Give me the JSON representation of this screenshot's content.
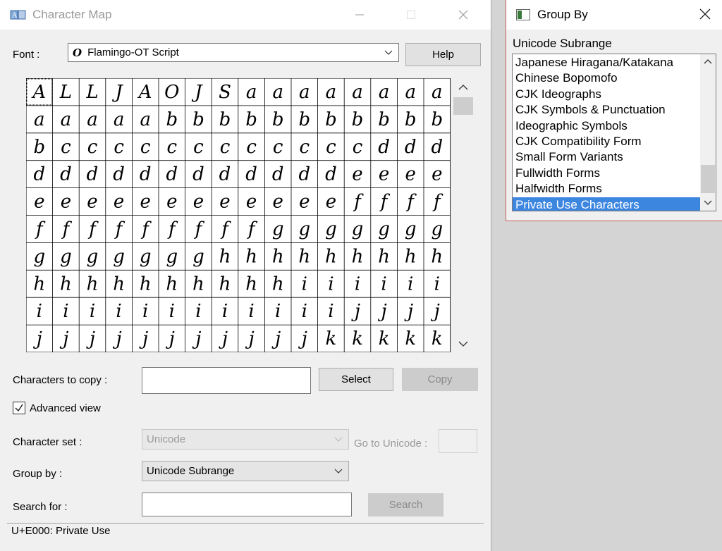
{
  "charmap": {
    "title": "Character Map",
    "font_label": "Font :",
    "font_value": "Flamingo-OT Script",
    "help_label": "Help",
    "chars_to_copy_label": "Characters to copy :",
    "chars_to_copy_value": "",
    "select_label": "Select",
    "copy_label": "Copy",
    "advanced_view_label": "Advanced view",
    "advanced_view_checked": true,
    "charset_label": "Character set :",
    "charset_value": "Unicode",
    "goto_unicode_label": "Go to Unicode :",
    "groupby_label": "Group by :",
    "groupby_value": "Unicode Subrange",
    "search_label": "Search for :",
    "search_value": "",
    "search_button_label": "Search",
    "status_text": "U+E000: Private Use",
    "grid": {
      "columns": 16,
      "rows": 10,
      "glyph_rows": [
        [
          "A",
          "L",
          "L",
          "J",
          "A",
          "O",
          "J",
          "S",
          "a",
          "a",
          "a",
          "a",
          "a",
          "a",
          "a",
          "a"
        ],
        [
          "a",
          "a",
          "a",
          "a",
          "a",
          "b",
          "b",
          "b",
          "b",
          "b",
          "b",
          "b",
          "b",
          "b",
          "b",
          "b"
        ],
        [
          "b",
          "c",
          "c",
          "c",
          "c",
          "c",
          "c",
          "c",
          "c",
          "c",
          "c",
          "c",
          "c",
          "d",
          "d",
          "d"
        ],
        [
          "d",
          "d",
          "d",
          "d",
          "d",
          "d",
          "d",
          "d",
          "d",
          "d",
          "d",
          "d",
          "e",
          "e",
          "e",
          "e"
        ],
        [
          "e",
          "e",
          "e",
          "e",
          "e",
          "e",
          "e",
          "e",
          "e",
          "e",
          "e",
          "e",
          "f",
          "f",
          "f",
          "f"
        ],
        [
          "f",
          "f",
          "f",
          "f",
          "f",
          "f",
          "f",
          "f",
          "f",
          "g",
          "g",
          "g",
          "g",
          "g",
          "g",
          "g"
        ],
        [
          "g",
          "g",
          "g",
          "g",
          "g",
          "g",
          "g",
          "h",
          "h",
          "h",
          "h",
          "h",
          "h",
          "h",
          "h",
          "h"
        ],
        [
          "h",
          "h",
          "h",
          "h",
          "h",
          "h",
          "h",
          "h",
          "h",
          "h",
          "i",
          "i",
          "i",
          "i",
          "i",
          "i"
        ],
        [
          "i",
          "i",
          "i",
          "i",
          "i",
          "i",
          "i",
          "i",
          "i",
          "i",
          "i",
          "i",
          "j",
          "j",
          "j",
          "j"
        ],
        [
          "j",
          "j",
          "j",
          "j",
          "j",
          "j",
          "j",
          "j",
          "j",
          "j",
          "j",
          "k",
          "k",
          "k",
          "k",
          "k"
        ]
      ]
    }
  },
  "groupby": {
    "title": "Group By",
    "header": "Unicode Subrange",
    "items": [
      "Japanese Hiragana/Katakana",
      "Chinese Bopomofo",
      "CJK Ideographs",
      "CJK Symbols & Punctuation",
      "Ideographic Symbols",
      "CJK Compatibility Form",
      "Small Form Variants",
      "Fullwidth Forms",
      "Halfwidth Forms",
      "Private Use Characters"
    ],
    "selected": "Private Use Characters"
  },
  "icons": [
    "charmap-app-icon",
    "minimize-icon",
    "maximize-icon",
    "close-icon",
    "chevron-down-icon",
    "chevron-up-icon",
    "checkmark-icon",
    "window-icon"
  ],
  "colors": {
    "selection": "#3d86e0",
    "window_bg": "#f0f0f0",
    "desktop_bg": "#d4d4d4",
    "disabled_text": "#9a9a9a"
  }
}
